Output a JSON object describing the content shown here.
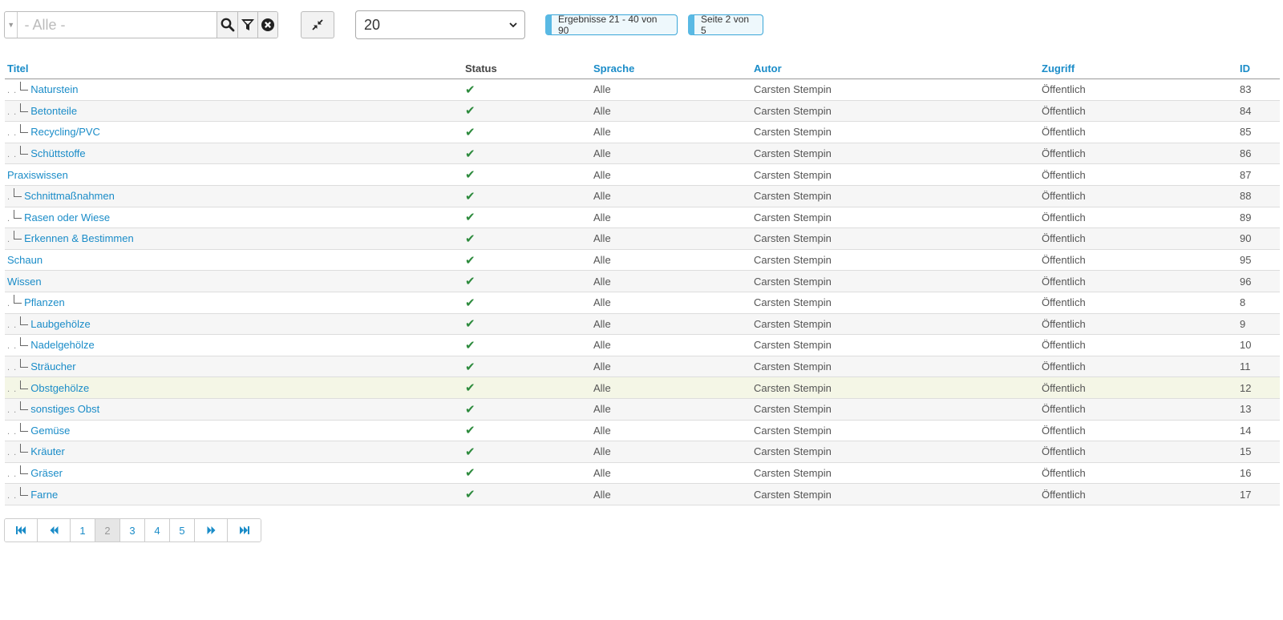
{
  "filter": {
    "placeholder": "- Alle -",
    "search_icon": "search-icon",
    "filter_icon": "funnel-icon",
    "clear_icon": "clear-circle-icon",
    "collapse_icon": "compress-arrows-icon"
  },
  "limit": {
    "value": "20"
  },
  "badges": {
    "results": "Ergebnisse 21 - 40 von 90",
    "page": "Seite 2 von 5"
  },
  "table": {
    "headers": {
      "title": "Titel",
      "status": "Status",
      "language": "Sprache",
      "author": "Autor",
      "access": "Zugriff",
      "id": "ID"
    },
    "rows": [
      {
        "indent": ". . ",
        "tree": true,
        "title": "Naturstein",
        "status": "✔",
        "language": "Alle",
        "author": "Carsten Stempin",
        "access": "Öffentlich",
        "id": "83"
      },
      {
        "indent": ". . ",
        "tree": true,
        "title": "Betonteile",
        "status": "✔",
        "language": "Alle",
        "author": "Carsten Stempin",
        "access": "Öffentlich",
        "id": "84"
      },
      {
        "indent": ". . ",
        "tree": true,
        "title": "Recycling/PVC",
        "status": "✔",
        "language": "Alle",
        "author": "Carsten Stempin",
        "access": "Öffentlich",
        "id": "85"
      },
      {
        "indent": ". . ",
        "tree": true,
        "title": "Schüttstoffe",
        "status": "✔",
        "language": "Alle",
        "author": "Carsten Stempin",
        "access": "Öffentlich",
        "id": "86"
      },
      {
        "indent": "",
        "tree": false,
        "title": "Praxiswissen",
        "status": "✔",
        "language": "Alle",
        "author": "Carsten Stempin",
        "access": "Öffentlich",
        "id": "87"
      },
      {
        "indent": ". ",
        "tree": true,
        "title": "Schnittmaßnahmen",
        "status": "✔",
        "language": "Alle",
        "author": "Carsten Stempin",
        "access": "Öffentlich",
        "id": "88"
      },
      {
        "indent": ". ",
        "tree": true,
        "title": "Rasen oder Wiese",
        "status": "✔",
        "language": "Alle",
        "author": "Carsten Stempin",
        "access": "Öffentlich",
        "id": "89"
      },
      {
        "indent": ". ",
        "tree": true,
        "title": "Erkennen & Bestimmen",
        "status": "✔",
        "language": "Alle",
        "author": "Carsten Stempin",
        "access": "Öffentlich",
        "id": "90"
      },
      {
        "indent": "",
        "tree": false,
        "title": "Schaun",
        "status": "✔",
        "language": "Alle",
        "author": "Carsten Stempin",
        "access": "Öffentlich",
        "id": "95"
      },
      {
        "indent": "",
        "tree": false,
        "title": "Wissen",
        "status": "✔",
        "language": "Alle",
        "author": "Carsten Stempin",
        "access": "Öffentlich",
        "id": "96"
      },
      {
        "indent": ". ",
        "tree": true,
        "title": "Pflanzen",
        "status": "✔",
        "language": "Alle",
        "author": "Carsten Stempin",
        "access": "Öffentlich",
        "id": "8"
      },
      {
        "indent": ". . ",
        "tree": true,
        "title": "Laubgehölze",
        "status": "✔",
        "language": "Alle",
        "author": "Carsten Stempin",
        "access": "Öffentlich",
        "id": "9"
      },
      {
        "indent": ". . ",
        "tree": true,
        "title": "Nadelgehölze",
        "status": "✔",
        "language": "Alle",
        "author": "Carsten Stempin",
        "access": "Öffentlich",
        "id": "10"
      },
      {
        "indent": ". . ",
        "tree": true,
        "title": "Sträucher",
        "status": "✔",
        "language": "Alle",
        "author": "Carsten Stempin",
        "access": "Öffentlich",
        "id": "11"
      },
      {
        "indent": ". . ",
        "tree": true,
        "title": "Obstgehölze",
        "status": "✔",
        "language": "Alle",
        "author": "Carsten Stempin",
        "access": "Öffentlich",
        "id": "12",
        "highlight": true
      },
      {
        "indent": ". . ",
        "tree": true,
        "title": "sonstiges Obst",
        "status": "✔",
        "language": "Alle",
        "author": "Carsten Stempin",
        "access": "Öffentlich",
        "id": "13"
      },
      {
        "indent": ". . ",
        "tree": true,
        "title": "Gemüse",
        "status": "✔",
        "language": "Alle",
        "author": "Carsten Stempin",
        "access": "Öffentlich",
        "id": "14"
      },
      {
        "indent": ". . ",
        "tree": true,
        "title": "Kräuter",
        "status": "✔",
        "language": "Alle",
        "author": "Carsten Stempin",
        "access": "Öffentlich",
        "id": "15"
      },
      {
        "indent": ". . ",
        "tree": true,
        "title": "Gräser",
        "status": "✔",
        "language": "Alle",
        "author": "Carsten Stempin",
        "access": "Öffentlich",
        "id": "16"
      },
      {
        "indent": ". . ",
        "tree": true,
        "title": "Farne",
        "status": "✔",
        "language": "Alle",
        "author": "Carsten Stempin",
        "access": "Öffentlich",
        "id": "17"
      }
    ]
  },
  "pagination": {
    "first_icon": "first-page-icon",
    "prev_icon": "previous-page-icon",
    "pages": [
      "1",
      "2",
      "3",
      "4",
      "5"
    ],
    "active": "2",
    "next_icon": "next-page-icon",
    "last_icon": "last-page-icon"
  },
  "colors": {
    "link": "#1a8cc8",
    "check": "#2c8a3c",
    "badge_accent": "#59b9e4",
    "highlight_row": "#f4f6e6"
  }
}
